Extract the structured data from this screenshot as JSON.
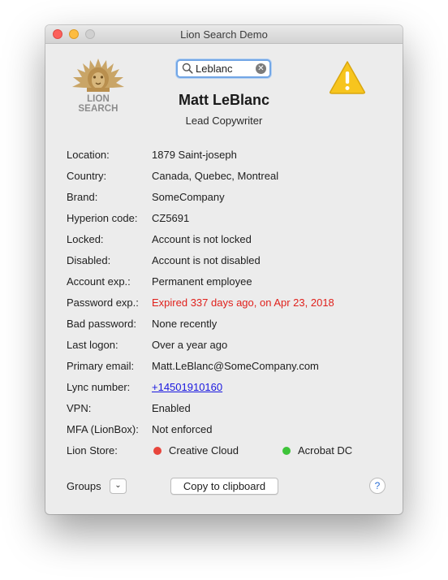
{
  "window": {
    "title": "Lion Search Demo"
  },
  "logo": {
    "text": "LION SEARCH"
  },
  "search": {
    "value": "Leblanc"
  },
  "person": {
    "name": "Matt LeBlanc",
    "title": "Lead Copywriter"
  },
  "fields": {
    "location": {
      "label": "Location:",
      "value": "1879 Saint-joseph"
    },
    "country": {
      "label": "Country:",
      "value": "Canada, Quebec, Montreal"
    },
    "brand": {
      "label": "Brand:",
      "value": "SomeCompany"
    },
    "hyperion": {
      "label": "Hyperion code:",
      "value": "CZ5691"
    },
    "locked": {
      "label": "Locked:",
      "value": "Account is not locked"
    },
    "disabled": {
      "label": "Disabled:",
      "value": "Account is not disabled"
    },
    "account_exp": {
      "label": "Account exp.:",
      "value": "Permanent employee"
    },
    "password_exp": {
      "label": "Password exp.:",
      "value": "Expired 337 days ago, on Apr 23, 2018"
    },
    "bad_password": {
      "label": "Bad password:",
      "value": "None recently"
    },
    "last_logon": {
      "label": "Last logon:",
      "value": "Over a year ago"
    },
    "primary_email": {
      "label": "Primary email:",
      "value": "Matt.LeBlanc@SomeCompany.com"
    },
    "lync": {
      "label": "Lync number:",
      "value": "+14501910160"
    },
    "vpn": {
      "label": "VPN:",
      "value": "Enabled"
    },
    "mfa": {
      "label": "MFA (LionBox):",
      "value": "Not enforced"
    }
  },
  "lion_store": {
    "label": "Lion Store:",
    "items": [
      {
        "name": "Creative Cloud",
        "status_color": "#e8453c"
      },
      {
        "name": "Acrobat DC",
        "status_color": "#3ec43a"
      }
    ]
  },
  "footer": {
    "groups_label": "Groups",
    "groups_button_icon": "chevron-down-icon",
    "copy_button": "Copy to clipboard",
    "help_icon": "?"
  },
  "colors": {
    "expired": "#e0211c",
    "link": "#1a18e0",
    "warning": "#f7c51e"
  }
}
